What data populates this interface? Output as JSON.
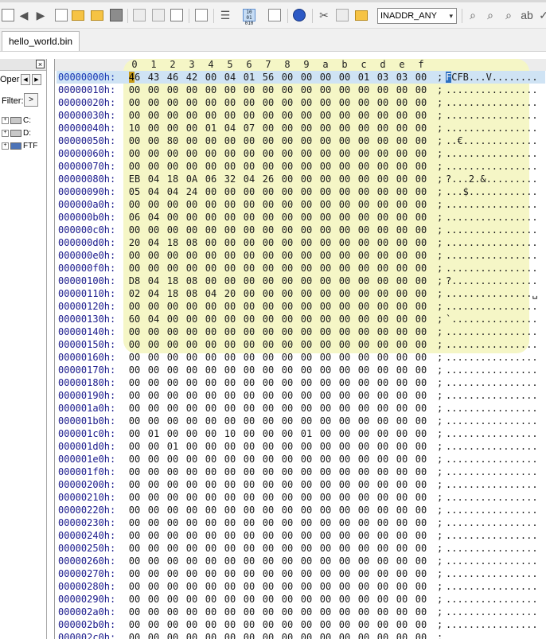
{
  "toolbar": {
    "address_value": "INADDR_ANY",
    "address_arrow": "▾",
    "buttons": [
      "address-book-icon",
      "back-icon",
      "forward-icon",
      "new-icon",
      "open-icon",
      "open-folder-icon",
      "save-icon",
      "print-icon",
      "print-preview-icon",
      "export-icon",
      "page-icon",
      "wrap-icon",
      "hex-mode-icon",
      "document-icon",
      "internet-icon",
      "cut-icon",
      "copy-icon",
      "paste-icon",
      "find-icon",
      "find-next-icon",
      "find-previous-icon",
      "replace-icon",
      "spell-icon"
    ],
    "hex_mode_label": "10\n01\n010"
  },
  "tabs": [
    {
      "label": "hello_world.bin"
    }
  ],
  "left_panel": {
    "close_label": "×",
    "open_label": "Oper",
    "nav_prev": "◀",
    "nav_next": "▶",
    "filter_label": "Filter:",
    "filter_button": ">",
    "tree": [
      {
        "label": "C:",
        "expander": "+"
      },
      {
        "label": "D:",
        "expander": "+"
      },
      {
        "label": "FTF",
        "expander": "+"
      }
    ]
  },
  "hex_editor": {
    "column_headers": [
      "0",
      "1",
      "2",
      "3",
      "4",
      "5",
      "6",
      "7",
      "8",
      "9",
      "a",
      "b",
      "c",
      "d",
      "e",
      "f"
    ],
    "rows": [
      {
        "offset": "00000000h:",
        "bytes": [
          "46",
          "43",
          "46",
          "42",
          "00",
          "04",
          "01",
          "56",
          "00",
          "00",
          "00",
          "00",
          "01",
          "03",
          "03",
          "00"
        ],
        "ascii": "FCFB...V........"
      },
      {
        "offset": "00000010h:",
        "bytes": [
          "00",
          "00",
          "00",
          "00",
          "00",
          "00",
          "00",
          "00",
          "00",
          "00",
          "00",
          "00",
          "00",
          "00",
          "00",
          "00"
        ],
        "ascii": "................"
      },
      {
        "offset": "00000020h:",
        "bytes": [
          "00",
          "00",
          "00",
          "00",
          "00",
          "00",
          "00",
          "00",
          "00",
          "00",
          "00",
          "00",
          "00",
          "00",
          "00",
          "00"
        ],
        "ascii": "................"
      },
      {
        "offset": "00000030h:",
        "bytes": [
          "00",
          "00",
          "00",
          "00",
          "00",
          "00",
          "00",
          "00",
          "00",
          "00",
          "00",
          "00",
          "00",
          "00",
          "00",
          "00"
        ],
        "ascii": "................"
      },
      {
        "offset": "00000040h:",
        "bytes": [
          "10",
          "00",
          "00",
          "00",
          "01",
          "04",
          "07",
          "00",
          "00",
          "00",
          "00",
          "00",
          "00",
          "00",
          "00",
          "00"
        ],
        "ascii": "................"
      },
      {
        "offset": "00000050h:",
        "bytes": [
          "00",
          "00",
          "80",
          "00",
          "00",
          "00",
          "00",
          "00",
          "00",
          "00",
          "00",
          "00",
          "00",
          "00",
          "00",
          "00"
        ],
        "ascii": "..€............."
      },
      {
        "offset": "00000060h:",
        "bytes": [
          "00",
          "00",
          "00",
          "00",
          "00",
          "00",
          "00",
          "00",
          "00",
          "00",
          "00",
          "00",
          "00",
          "00",
          "00",
          "00"
        ],
        "ascii": "................"
      },
      {
        "offset": "00000070h:",
        "bytes": [
          "00",
          "00",
          "00",
          "00",
          "00",
          "00",
          "00",
          "00",
          "00",
          "00",
          "00",
          "00",
          "00",
          "00",
          "00",
          "00"
        ],
        "ascii": "................"
      },
      {
        "offset": "00000080h:",
        "bytes": [
          "EB",
          "04",
          "18",
          "0A",
          "06",
          "32",
          "04",
          "26",
          "00",
          "00",
          "00",
          "00",
          "00",
          "00",
          "00",
          "00"
        ],
        "ascii": "?...2.&........."
      },
      {
        "offset": "00000090h:",
        "bytes": [
          "05",
          "04",
          "04",
          "24",
          "00",
          "00",
          "00",
          "00",
          "00",
          "00",
          "00",
          "00",
          "00",
          "00",
          "00",
          "00"
        ],
        "ascii": "...$............"
      },
      {
        "offset": "000000a0h:",
        "bytes": [
          "00",
          "00",
          "00",
          "00",
          "00",
          "00",
          "00",
          "00",
          "00",
          "00",
          "00",
          "00",
          "00",
          "00",
          "00",
          "00"
        ],
        "ascii": "................"
      },
      {
        "offset": "000000b0h:",
        "bytes": [
          "06",
          "04",
          "00",
          "00",
          "00",
          "00",
          "00",
          "00",
          "00",
          "00",
          "00",
          "00",
          "00",
          "00",
          "00",
          "00"
        ],
        "ascii": "................"
      },
      {
        "offset": "000000c0h:",
        "bytes": [
          "00",
          "00",
          "00",
          "00",
          "00",
          "00",
          "00",
          "00",
          "00",
          "00",
          "00",
          "00",
          "00",
          "00",
          "00",
          "00"
        ],
        "ascii": "................"
      },
      {
        "offset": "000000d0h:",
        "bytes": [
          "20",
          "04",
          "18",
          "08",
          "00",
          "00",
          "00",
          "00",
          "00",
          "00",
          "00",
          "00",
          "00",
          "00",
          "00",
          "00"
        ],
        "ascii": "................"
      },
      {
        "offset": "000000e0h:",
        "bytes": [
          "00",
          "00",
          "00",
          "00",
          "00",
          "00",
          "00",
          "00",
          "00",
          "00",
          "00",
          "00",
          "00",
          "00",
          "00",
          "00"
        ],
        "ascii": "................"
      },
      {
        "offset": "000000f0h:",
        "bytes": [
          "00",
          "00",
          "00",
          "00",
          "00",
          "00",
          "00",
          "00",
          "00",
          "00",
          "00",
          "00",
          "00",
          "00",
          "00",
          "00"
        ],
        "ascii": "................"
      },
      {
        "offset": "00000100h:",
        "bytes": [
          "D8",
          "04",
          "18",
          "08",
          "00",
          "00",
          "00",
          "00",
          "00",
          "00",
          "00",
          "00",
          "00",
          "00",
          "00",
          "00"
        ],
        "ascii": "?..............."
      },
      {
        "offset": "00000110h:",
        "bytes": [
          "02",
          "04",
          "18",
          "08",
          "04",
          "20",
          "00",
          "00",
          "00",
          "00",
          "00",
          "00",
          "00",
          "00",
          "00",
          "00"
        ],
        "ascii": "...............␣"
      },
      {
        "offset": "00000120h:",
        "bytes": [
          "00",
          "00",
          "00",
          "00",
          "00",
          "00",
          "00",
          "00",
          "00",
          "00",
          "00",
          "00",
          "00",
          "00",
          "00",
          "00"
        ],
        "ascii": "................"
      },
      {
        "offset": "00000130h:",
        "bytes": [
          "60",
          "04",
          "00",
          "00",
          "00",
          "00",
          "00",
          "00",
          "00",
          "00",
          "00",
          "00",
          "00",
          "00",
          "00",
          "00"
        ],
        "ascii": "`..............."
      },
      {
        "offset": "00000140h:",
        "bytes": [
          "00",
          "00",
          "00",
          "00",
          "00",
          "00",
          "00",
          "00",
          "00",
          "00",
          "00",
          "00",
          "00",
          "00",
          "00",
          "00"
        ],
        "ascii": "................"
      },
      {
        "offset": "00000150h:",
        "bytes": [
          "00",
          "00",
          "00",
          "00",
          "00",
          "00",
          "00",
          "00",
          "00",
          "00",
          "00",
          "00",
          "00",
          "00",
          "00",
          "00"
        ],
        "ascii": "................"
      },
      {
        "offset": "00000160h:",
        "bytes": [
          "00",
          "00",
          "00",
          "00",
          "00",
          "00",
          "00",
          "00",
          "00",
          "00",
          "00",
          "00",
          "00",
          "00",
          "00",
          "00"
        ],
        "ascii": "................"
      },
      {
        "offset": "00000170h:",
        "bytes": [
          "00",
          "00",
          "00",
          "00",
          "00",
          "00",
          "00",
          "00",
          "00",
          "00",
          "00",
          "00",
          "00",
          "00",
          "00",
          "00"
        ],
        "ascii": "................"
      },
      {
        "offset": "00000180h:",
        "bytes": [
          "00",
          "00",
          "00",
          "00",
          "00",
          "00",
          "00",
          "00",
          "00",
          "00",
          "00",
          "00",
          "00",
          "00",
          "00",
          "00"
        ],
        "ascii": "................"
      },
      {
        "offset": "00000190h:",
        "bytes": [
          "00",
          "00",
          "00",
          "00",
          "00",
          "00",
          "00",
          "00",
          "00",
          "00",
          "00",
          "00",
          "00",
          "00",
          "00",
          "00"
        ],
        "ascii": "................"
      },
      {
        "offset": "000001a0h:",
        "bytes": [
          "00",
          "00",
          "00",
          "00",
          "00",
          "00",
          "00",
          "00",
          "00",
          "00",
          "00",
          "00",
          "00",
          "00",
          "00",
          "00"
        ],
        "ascii": "................"
      },
      {
        "offset": "000001b0h:",
        "bytes": [
          "00",
          "00",
          "00",
          "00",
          "00",
          "00",
          "00",
          "00",
          "00",
          "00",
          "00",
          "00",
          "00",
          "00",
          "00",
          "00"
        ],
        "ascii": "................"
      },
      {
        "offset": "000001c0h:",
        "bytes": [
          "00",
          "01",
          "00",
          "00",
          "00",
          "10",
          "00",
          "00",
          "00",
          "01",
          "00",
          "00",
          "00",
          "00",
          "00",
          "00"
        ],
        "ascii": "................"
      },
      {
        "offset": "000001d0h:",
        "bytes": [
          "00",
          "00",
          "01",
          "00",
          "00",
          "00",
          "00",
          "00",
          "00",
          "00",
          "00",
          "00",
          "00",
          "00",
          "00",
          "00"
        ],
        "ascii": "................"
      },
      {
        "offset": "000001e0h:",
        "bytes": [
          "00",
          "00",
          "00",
          "00",
          "00",
          "00",
          "00",
          "00",
          "00",
          "00",
          "00",
          "00",
          "00",
          "00",
          "00",
          "00"
        ],
        "ascii": "................"
      },
      {
        "offset": "000001f0h:",
        "bytes": [
          "00",
          "00",
          "00",
          "00",
          "00",
          "00",
          "00",
          "00",
          "00",
          "00",
          "00",
          "00",
          "00",
          "00",
          "00",
          "00"
        ],
        "ascii": "................"
      },
      {
        "offset": "00000200h:",
        "bytes": [
          "00",
          "00",
          "00",
          "00",
          "00",
          "00",
          "00",
          "00",
          "00",
          "00",
          "00",
          "00",
          "00",
          "00",
          "00",
          "00"
        ],
        "ascii": "................"
      },
      {
        "offset": "00000210h:",
        "bytes": [
          "00",
          "00",
          "00",
          "00",
          "00",
          "00",
          "00",
          "00",
          "00",
          "00",
          "00",
          "00",
          "00",
          "00",
          "00",
          "00"
        ],
        "ascii": "................"
      },
      {
        "offset": "00000220h:",
        "bytes": [
          "00",
          "00",
          "00",
          "00",
          "00",
          "00",
          "00",
          "00",
          "00",
          "00",
          "00",
          "00",
          "00",
          "00",
          "00",
          "00"
        ],
        "ascii": "................"
      },
      {
        "offset": "00000230h:",
        "bytes": [
          "00",
          "00",
          "00",
          "00",
          "00",
          "00",
          "00",
          "00",
          "00",
          "00",
          "00",
          "00",
          "00",
          "00",
          "00",
          "00"
        ],
        "ascii": "................"
      },
      {
        "offset": "00000240h:",
        "bytes": [
          "00",
          "00",
          "00",
          "00",
          "00",
          "00",
          "00",
          "00",
          "00",
          "00",
          "00",
          "00",
          "00",
          "00",
          "00",
          "00"
        ],
        "ascii": "................"
      },
      {
        "offset": "00000250h:",
        "bytes": [
          "00",
          "00",
          "00",
          "00",
          "00",
          "00",
          "00",
          "00",
          "00",
          "00",
          "00",
          "00",
          "00",
          "00",
          "00",
          "00"
        ],
        "ascii": "................"
      },
      {
        "offset": "00000260h:",
        "bytes": [
          "00",
          "00",
          "00",
          "00",
          "00",
          "00",
          "00",
          "00",
          "00",
          "00",
          "00",
          "00",
          "00",
          "00",
          "00",
          "00"
        ],
        "ascii": "................"
      },
      {
        "offset": "00000270h:",
        "bytes": [
          "00",
          "00",
          "00",
          "00",
          "00",
          "00",
          "00",
          "00",
          "00",
          "00",
          "00",
          "00",
          "00",
          "00",
          "00",
          "00"
        ],
        "ascii": "................"
      },
      {
        "offset": "00000280h:",
        "bytes": [
          "00",
          "00",
          "00",
          "00",
          "00",
          "00",
          "00",
          "00",
          "00",
          "00",
          "00",
          "00",
          "00",
          "00",
          "00",
          "00"
        ],
        "ascii": "................"
      },
      {
        "offset": "00000290h:",
        "bytes": [
          "00",
          "00",
          "00",
          "00",
          "00",
          "00",
          "00",
          "00",
          "00",
          "00",
          "00",
          "00",
          "00",
          "00",
          "00",
          "00"
        ],
        "ascii": "................"
      },
      {
        "offset": "000002a0h:",
        "bytes": [
          "00",
          "00",
          "00",
          "00",
          "00",
          "00",
          "00",
          "00",
          "00",
          "00",
          "00",
          "00",
          "00",
          "00",
          "00",
          "00"
        ],
        "ascii": "................"
      },
      {
        "offset": "000002b0h:",
        "bytes": [
          "00",
          "00",
          "00",
          "00",
          "00",
          "00",
          "00",
          "00",
          "00",
          "00",
          "00",
          "00",
          "00",
          "00",
          "00",
          "00"
        ],
        "ascii": "................"
      },
      {
        "offset": "000002c0h:",
        "bytes": [
          "00",
          "00",
          "00",
          "00",
          "00",
          "00",
          "00",
          "00",
          "00",
          "00",
          "00",
          "00",
          "00",
          "00",
          "00",
          "00"
        ],
        "ascii": "................"
      }
    ],
    "semicolon": ";",
    "colors": {
      "highlight": "#f5f6c6",
      "selected_row": "#cfe3f4",
      "cursor_hex": "#c69a18",
      "cursor_ascii": "#2c6fbf"
    }
  }
}
